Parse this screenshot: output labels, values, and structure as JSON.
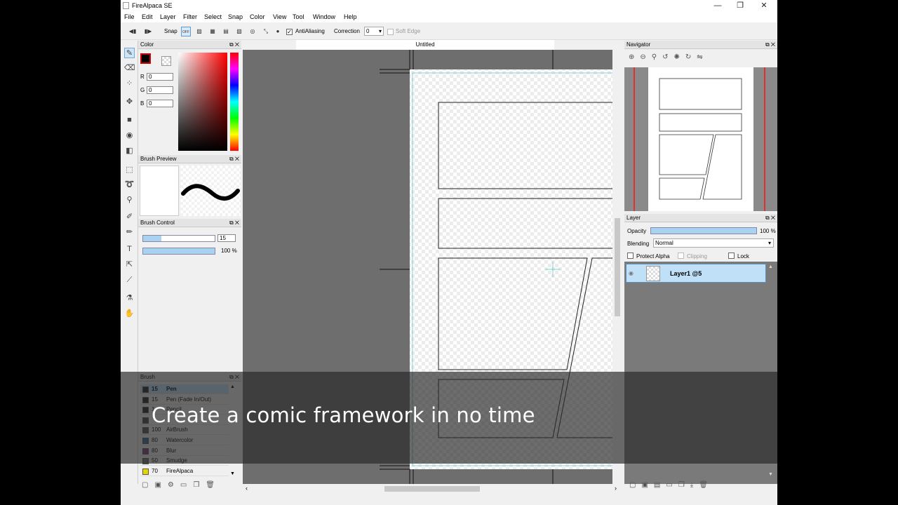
{
  "window": {
    "title": "FireAlpaca SE",
    "minimize": "—",
    "restore": "❐",
    "close": "✕"
  },
  "menu": [
    "File",
    "Edit",
    "Layer",
    "Filter",
    "Select",
    "Snap",
    "Color",
    "View",
    "Tool",
    "Window",
    "Help"
  ],
  "toolbar": {
    "snap_label": "Snap",
    "snap_off": "OFF",
    "antialiasing_label": "AntiAliasing",
    "correction_label": "Correction",
    "correction_value": "0",
    "soft_edge_label": "Soft Edge"
  },
  "color_panel": {
    "title": "Color",
    "r_label": "R",
    "g_label": "G",
    "b_label": "B",
    "r": "0",
    "g": "0",
    "b": "0"
  },
  "brush_preview_panel": {
    "title": "Brush Preview"
  },
  "brush_control_panel": {
    "title": "Brush Control",
    "size": "15",
    "opacity": "100 %",
    "size_fraction": 0.25,
    "opacity_fraction": 1.0
  },
  "brush_panel": {
    "title": "Brush",
    "items": [
      {
        "size": "15",
        "name": "Pen",
        "color": "#222222",
        "selected": true
      },
      {
        "size": "15",
        "name": "Pen (Fade In/Out)",
        "color": "#222222"
      },
      {
        "size": "1",
        "name": "Pencil",
        "color": "#222222"
      },
      {
        "size": "",
        "name": "",
        "color": "#444444"
      },
      {
        "size": "100",
        "name": "AirBrush",
        "color": "#555555"
      },
      {
        "size": "80",
        "name": "Watercolor",
        "color": "#2f6f9f"
      },
      {
        "size": "80",
        "name": "Blur",
        "color": "#7a3f7a"
      },
      {
        "size": "50",
        "name": "Smudge",
        "color": "#6f6f6f"
      },
      {
        "size": "70",
        "name": "FireAlpaca",
        "color": "#e8d400"
      }
    ]
  },
  "document": {
    "tab_title": "Untitled"
  },
  "navigator_panel": {
    "title": "Navigator"
  },
  "layer_panel": {
    "title": "Layer",
    "opacity_label": "Opacity",
    "opacity_value": "100 %",
    "opacity_fraction": 1.0,
    "blending_label": "Blending",
    "blending_value": "Normal",
    "protect_alpha_label": "Protect Alpha",
    "clipping_label": "Clipping",
    "lock_label": "Lock",
    "layers": [
      {
        "name": "Layer1 @5"
      }
    ]
  },
  "caption": "Create a comic framework in no time",
  "colors": {
    "accent": "#a9d2f0",
    "canvas_bg": "#6e6e6e",
    "guide": "#7fd0d8",
    "nav_red": "#e03030"
  }
}
